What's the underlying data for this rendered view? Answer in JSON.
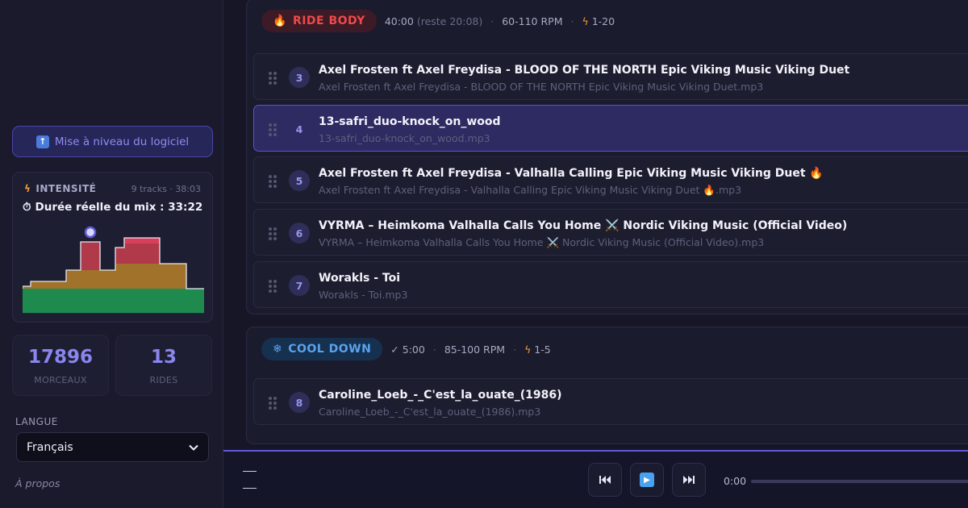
{
  "sidebar": {
    "upgrade_label": "Mise à niveau du logiciel",
    "intensity": {
      "title": "INTENSITÉ",
      "meta": "9 tracks · 38:03",
      "duration_label": "Durée réelle du mix : 33:22"
    },
    "stats": [
      {
        "value": "17896",
        "label": "MORCEAUX"
      },
      {
        "value": "13",
        "label": "RIDES"
      }
    ],
    "language_label": "LANGUE",
    "language_value": "Français",
    "about_label": "À propos"
  },
  "sections": [
    {
      "label": "RIDE BODY",
      "icon": "flame-icon",
      "duration": "40:00",
      "remaining": "(reste 20:08)",
      "rpm": "60-110 RPM",
      "intensity_range": "1-20",
      "color": "#ee4a4a",
      "tracks": [
        {
          "num": "3",
          "title": "Axel Frosten ft Axel Freydisa - BLOOD OF THE NORTH Epic Viking Music Viking Duet",
          "file": "Axel Frosten ft Axel Freydisa - BLOOD OF THE NORTH Epic Viking Music Viking Duet.mp3"
        },
        {
          "num": "4",
          "title": "13-safri_duo-knock_on_wood",
          "file": "13-safri_duo-knock_on_wood.mp3",
          "active": true
        },
        {
          "num": "5",
          "title": "Axel Frosten ft Axel Freydisa - Valhalla Calling Epic Viking Music Viking Duet 🔥",
          "file": "Axel Frosten ft Axel Freydisa - Valhalla Calling Epic Viking Music Viking Duet 🔥.mp3"
        },
        {
          "num": "6",
          "title": "VYRMA – Heimkoma Valhalla Calls You Home ⚔️ Nordic Viking Music (Official Video)",
          "file": "VYRMA – Heimkoma Valhalla Calls You Home ⚔️ Nordic Viking Music (Official Video).mp3"
        },
        {
          "num": "7",
          "title": "Worakls - Toi",
          "file": "Worakls - Toi.mp3"
        }
      ]
    },
    {
      "label": "COOL DOWN",
      "icon": "snowflake-icon",
      "duration": "✓ 5:00",
      "remaining": "",
      "rpm": "85-100 RPM",
      "intensity_range": "1-5",
      "color": "#5aa2ee",
      "tracks": [
        {
          "num": "8",
          "title": "Caroline_Loeb_-_C'est_la_ouate_(1986)",
          "file": "Caroline_Loeb_-_C'est_la_ouate_(1986).mp3"
        }
      ]
    }
  ],
  "player": {
    "time": "0:00"
  },
  "colors": {
    "accent": "#6058d8",
    "zone_green": "#1e8a4e",
    "zone_orange": "#a0722a",
    "zone_red": "#b03a4a"
  }
}
